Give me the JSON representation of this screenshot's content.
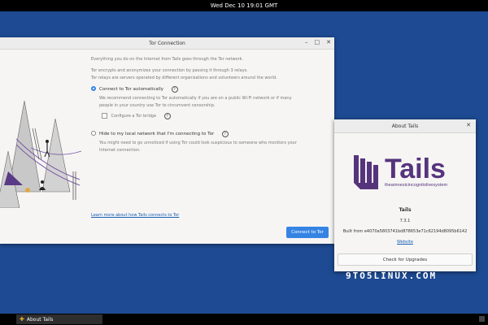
{
  "topbar": {
    "datetime": "Wed Dec 10  19:01 GMT"
  },
  "tor_window": {
    "title": "Tor Connection",
    "controls": [
      "–",
      "□",
      "✕"
    ],
    "intro": "Everything you do on the Internet from Tails goes through the Tor network.",
    "intro2": "Tor encrypts and anonymizes your connection by passing it through 3 relays.",
    "intro3": "Tor relays are servers operated by different organizations and volunteers around the world.",
    "option1": {
      "label": "Connect to Tor automatically",
      "desc1": "We recommend connecting to Tor automatically if you are on a public Wi-Fi network or if many",
      "desc2": "people in your country use Tor to circumvent censorship.",
      "checkbox_label": "Configure a Tor bridge"
    },
    "option2": {
      "label": "Hide to my local network that I'm connecting to Tor",
      "desc1": "You might need to go unnoticed if using Tor could look suspicious to someone who monitors your",
      "desc2": "Internet connection."
    },
    "learn_more": "Learn more about how Tails connects to Tor",
    "connect_button": "Connect to Tor"
  },
  "about_window": {
    "title": "About Tails",
    "close": "✕",
    "logo_text": "Tails",
    "tagline": "theamnesicincognitolivesystem",
    "app_name": "Tails",
    "version": "7.3.1",
    "build": "Built from e4070a5803741bd878653e71c62194d8095b6142",
    "website": "Website",
    "upgrade_button": "Check for Upgrades"
  },
  "watermark": "9TO5LINUX.COM",
  "taskbar": {
    "item_label": "About Tails",
    "item_icon": "tails-app-icon"
  },
  "colors": {
    "desktop": "#1d4a92",
    "accent": "#3584e4",
    "logo_purple": "#56347c"
  }
}
